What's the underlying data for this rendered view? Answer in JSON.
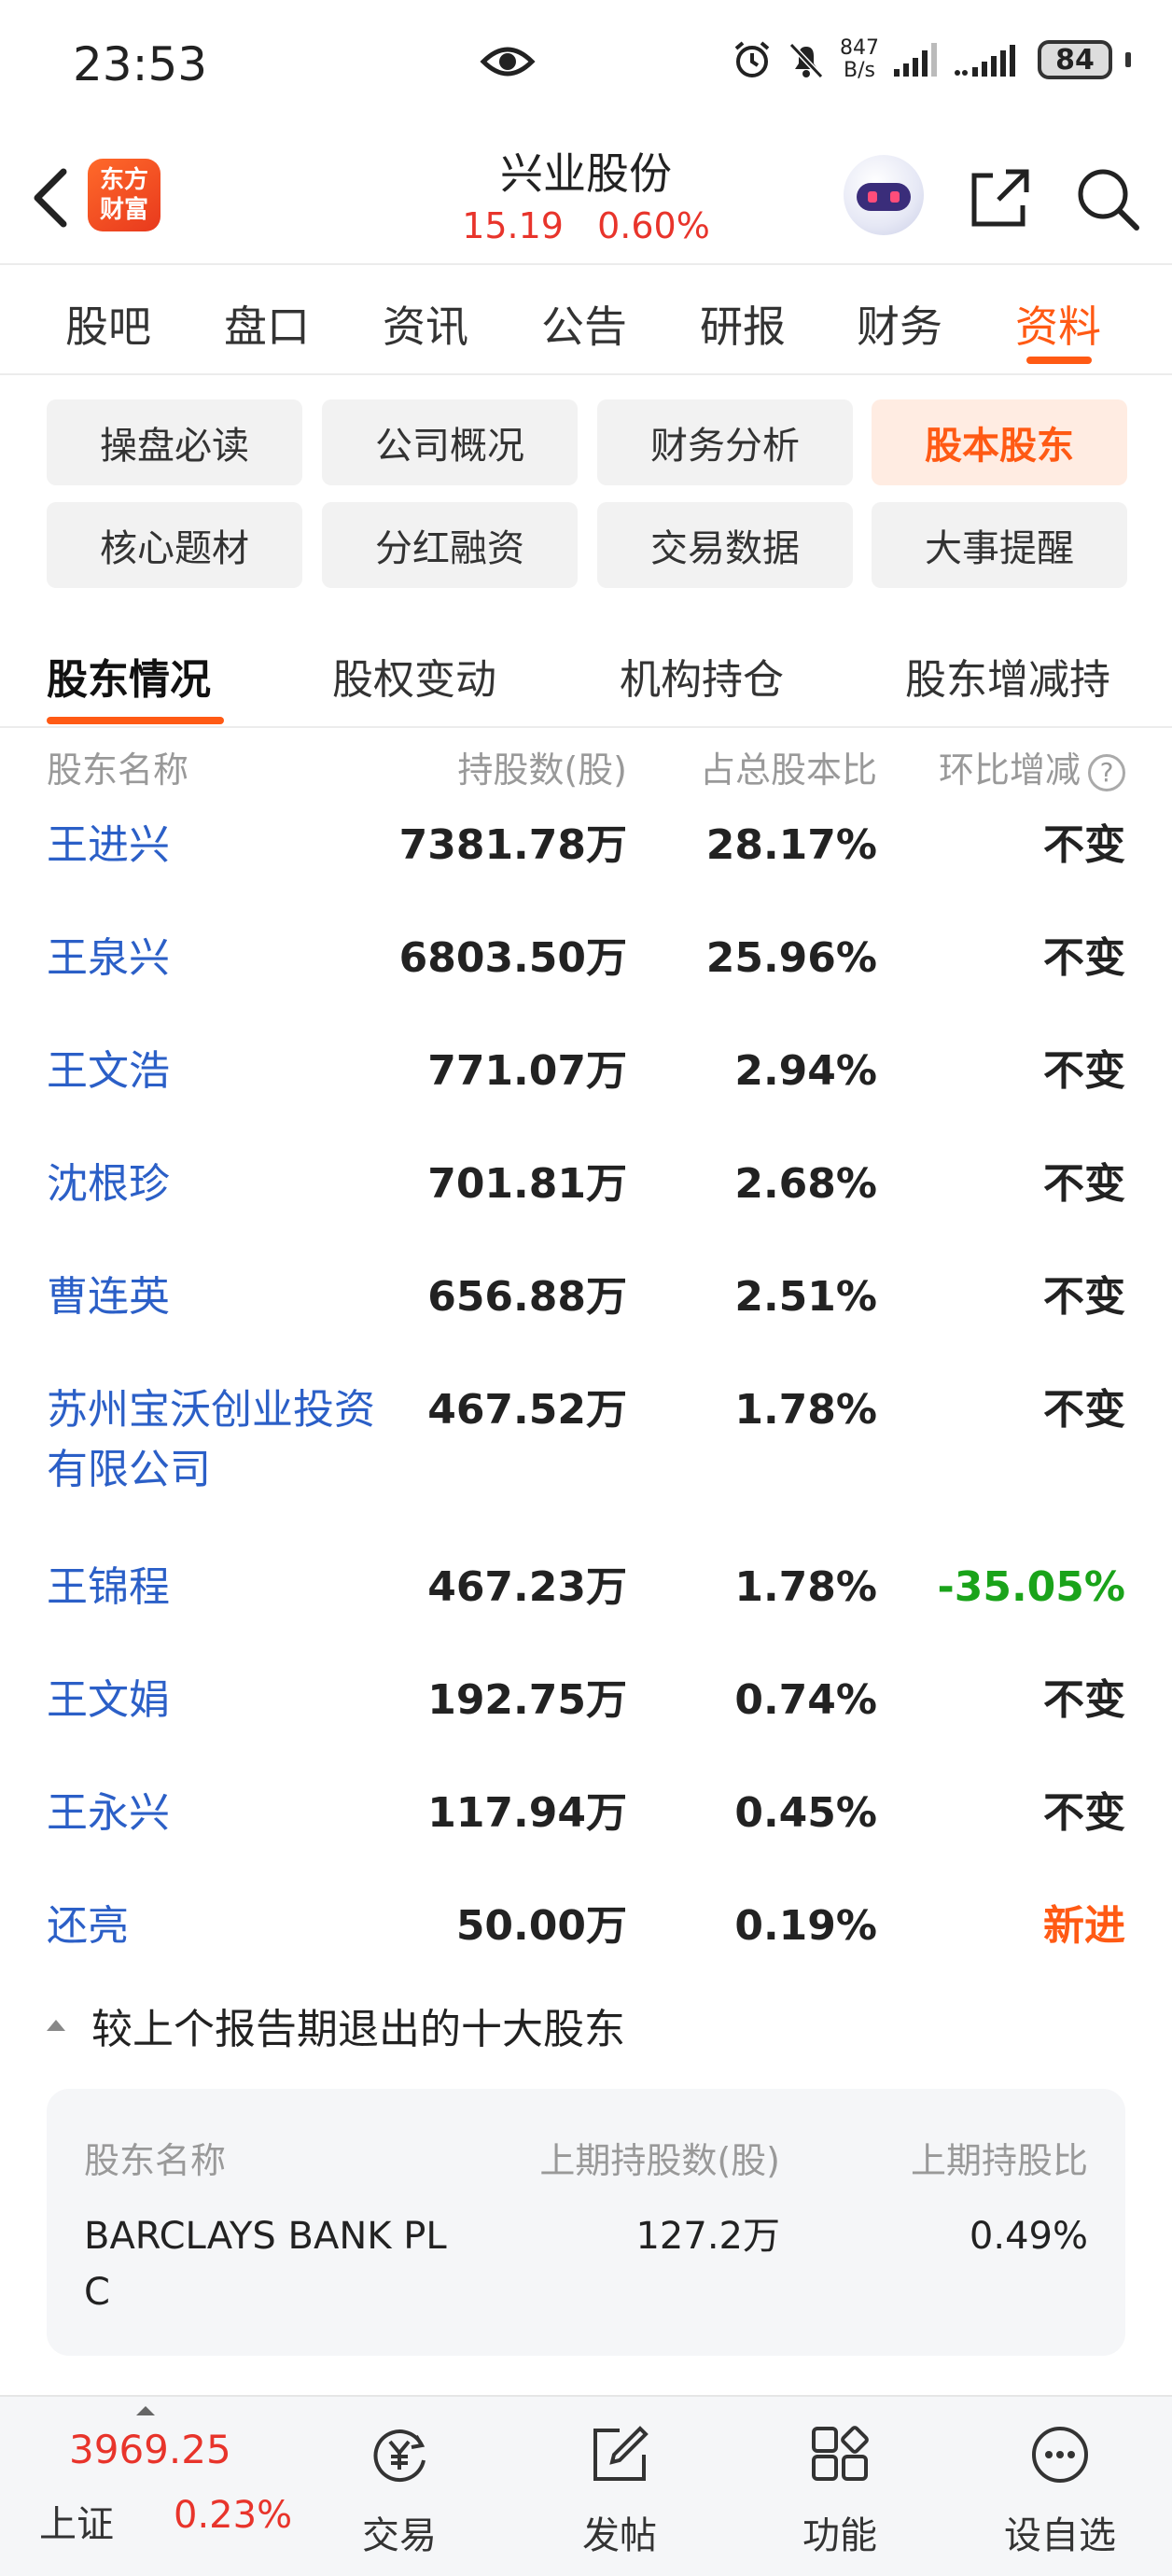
{
  "status_bar": {
    "time": "23:53",
    "net_speed_value": "847",
    "net_speed_unit": "B/s",
    "battery": "84"
  },
  "header": {
    "logo_line1": "东方",
    "logo_line2": "财富",
    "title": "兴业股份",
    "price": "15.19",
    "change_pct": "0.60%"
  },
  "main_tabs": [
    "股吧",
    "盘口",
    "资讯",
    "公告",
    "研报",
    "财务",
    "资料"
  ],
  "main_tabs_active": "资料",
  "chips": [
    "操盘必读",
    "公司概况",
    "财务分析",
    "股本股东",
    "核心题材",
    "分红融资",
    "交易数据",
    "大事提醒"
  ],
  "chips_active": "股本股东",
  "sub_tabs": [
    "股东情况",
    "股权变动",
    "机构持仓",
    "股东增减持"
  ],
  "sub_tabs_active": "股东情况",
  "table": {
    "headers": [
      "股东名称",
      "持股数(股)",
      "占总股本比",
      "环比增减"
    ],
    "rows": [
      {
        "name": "王进兴",
        "shares": "7381.78万",
        "ratio": "28.17%",
        "change": "不变"
      },
      {
        "name": "王泉兴",
        "shares": "6803.50万",
        "ratio": "25.96%",
        "change": "不变"
      },
      {
        "name": "王文浩",
        "shares": "771.07万",
        "ratio": "2.94%",
        "change": "不变"
      },
      {
        "name": "沈根珍",
        "shares": "701.81万",
        "ratio": "2.68%",
        "change": "不变"
      },
      {
        "name": "曹连英",
        "shares": "656.88万",
        "ratio": "2.51%",
        "change": "不变"
      },
      {
        "name": "苏州宝沃创业投资有限公司",
        "shares": "467.52万",
        "ratio": "1.78%",
        "change": "不变"
      },
      {
        "name": "王锦程",
        "shares": "467.23万",
        "ratio": "1.78%",
        "change": "-35.05%"
      },
      {
        "name": "王文娟",
        "shares": "192.75万",
        "ratio": "0.74%",
        "change": "不变"
      },
      {
        "name": "王永兴",
        "shares": "117.94万",
        "ratio": "0.45%",
        "change": "不变"
      },
      {
        "name": "还亮",
        "shares": "50.00万",
        "ratio": "0.19%",
        "change": "新进"
      }
    ]
  },
  "exited": {
    "title": "较上个报告期退出的十大股东",
    "headers": [
      "股东名称",
      "上期持股数(股)",
      "上期持股比"
    ],
    "rows": [
      {
        "name": "BARCLAYS BANK PLC",
        "shares": "127.2万",
        "ratio": "0.49%"
      }
    ]
  },
  "bottom_bar": {
    "index_value": "3969.25",
    "index_name": "上证",
    "index_pct": "0.23%",
    "items": [
      {
        "label": "交易",
        "icon": "trade-icon"
      },
      {
        "label": "发帖",
        "icon": "post-icon"
      },
      {
        "label": "功能",
        "icon": "grid-icon"
      },
      {
        "label": "设自选",
        "icon": "more-icon"
      }
    ]
  },
  "colors": {
    "accent": "#ff5a14",
    "up_red": "#e8342b",
    "down_green": "#1aa31a",
    "link_blue": "#2b5fc7"
  }
}
